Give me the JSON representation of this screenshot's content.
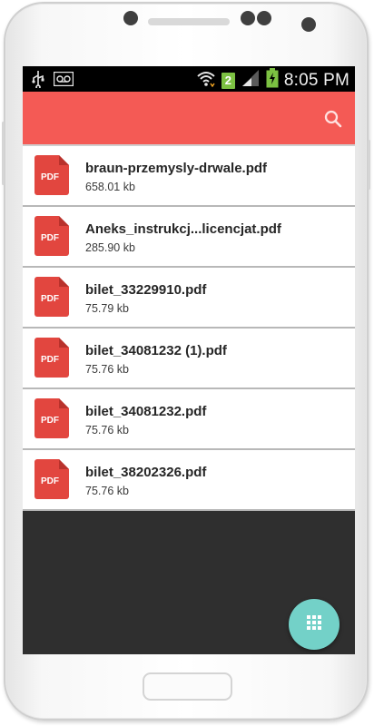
{
  "status_bar": {
    "time": "8:05 PM",
    "sim_slot": "2",
    "icons": [
      "usb-icon",
      "voicemail-icon",
      "wifi-icon",
      "signal-icon",
      "battery-charging-icon"
    ]
  },
  "app_bar": {
    "color": "#f45a55",
    "actions": [
      "search-icon"
    ]
  },
  "files": [
    {
      "name": "braun-przemysly-drwale.pdf",
      "size": "658.01 kb",
      "icon_label": "PDF"
    },
    {
      "name": "Aneks_instrukcj...licencjat.pdf",
      "size": "285.90 kb",
      "icon_label": "PDF"
    },
    {
      "name": "bilet_33229910.pdf",
      "size": "75.79 kb",
      "icon_label": "PDF"
    },
    {
      "name": "bilet_34081232 (1).pdf",
      "size": "75.76 kb",
      "icon_label": "PDF"
    },
    {
      "name": "bilet_34081232.pdf",
      "size": "75.76 kb",
      "icon_label": "PDF"
    },
    {
      "name": "bilet_38202326.pdf",
      "size": "75.76 kb",
      "icon_label": "PDF"
    }
  ],
  "fab": {
    "icon": "grid-icon",
    "color": "#73d1c8"
  },
  "colors": {
    "pdf_icon": "#e2463f",
    "list_background": "#2f2f2f"
  }
}
